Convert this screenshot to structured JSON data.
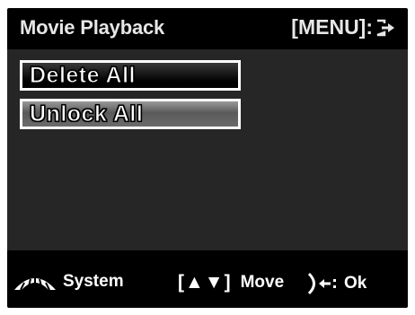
{
  "header": {
    "title": "Movie Playback",
    "menu_exit_label": "[MENU]:",
    "exit_icon": "exit-arrow-icon"
  },
  "menu": {
    "items": [
      {
        "label": "Delete All",
        "state": "normal"
      },
      {
        "label": "Unlock All",
        "state": "highlighted"
      }
    ]
  },
  "footer": {
    "system_label": "System",
    "system_icon": "mode-dial-icon",
    "move_brackets": "[▲▼]",
    "move_label": "Move",
    "ok_icon": "shutter-button-icon",
    "ok_label": "Ok"
  },
  "colors": {
    "header_bg": "#000000",
    "body_bg": "#262626",
    "text": "#ffffff",
    "highlight_border": "#ffffff"
  }
}
